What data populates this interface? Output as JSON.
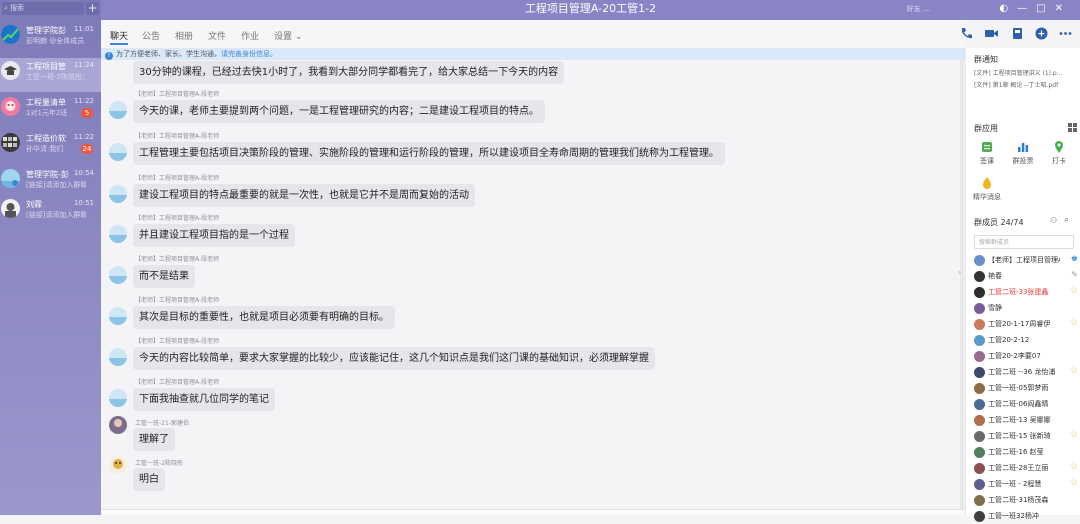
{
  "app": {
    "title": "工程项目管理A-20工管1-2",
    "titlebar_mini": "好友 …"
  },
  "left": {
    "search_placeholder": "搜索",
    "plus": "+",
    "sessions": [
      {
        "name": "管理学院彭",
        "time": "11:01",
        "preview": "彭明朗 @全体成员",
        "badge": ""
      },
      {
        "name": "工程项目管",
        "time": "11:24",
        "preview": "工管一班-2陈晓彤：明",
        "badge": ""
      },
      {
        "name": "工程量清单",
        "time": "11:22",
        "preview": "1对1元年2班",
        "badge": "5"
      },
      {
        "name": "工程造价软",
        "time": "11:22",
        "preview": "孙华清:我们",
        "badge": "24"
      },
      {
        "name": "管理学院-彭",
        "time": "10:54",
        "preview": "[链接]请添加入群聊",
        "badge": ""
      },
      {
        "name": "刘霖",
        "time": "10:51",
        "preview": "[链接]请添加入群聊",
        "badge": ""
      }
    ]
  },
  "tabs": [
    "聊天",
    "公告",
    "相册",
    "文件",
    "作业",
    "设置 ⌄"
  ],
  "notice": {
    "text": "为了方便老师、家长、学生沟通，",
    "link": "请完善身份信息。"
  },
  "messages": [
    {
      "sender": "",
      "text": "30分钟的课程，已经过去快1小时了，我看到大部分同学都看完了，给大家总结一下今天的内容"
    },
    {
      "sender": "【老师】工程项目管理A-段老师",
      "text": "今天的课，老师主要提到两个问题，一是工程管理研究的内容；二是建设工程项目的特点。"
    },
    {
      "sender": "【老师】工程项目管理A-段老师",
      "text": "工程管理主要包括项目决策阶段的管理、实施阶段的管理和运行阶段的管理，所以建设项目全寿命周期的管理我们统称为工程管理。"
    },
    {
      "sender": "【老师】工程项目管理A-段老师",
      "text": "建设工程项目的特点最重要的就是一次性，也就是它并不是周而复始的活动"
    },
    {
      "sender": "【老师】工程项目管理A-段老师",
      "text": "并且建设工程项目指的是一个过程"
    },
    {
      "sender": "【老师】工程项目管理A-段老师",
      "text": "而不是结果"
    },
    {
      "sender": "【老师】工程项目管理A-段老师",
      "text": "其次是目标的重要性，也就是项目必须要有明确的目标。"
    },
    {
      "sender": "【老师】工程项目管理A-段老师",
      "text": "今天的内容比较简单，要求大家掌握的比较少，应该能记住，这几个知识点是我们这门课的基础知识，必须理解掌握"
    },
    {
      "sender": "【老师】工程项目管理A-段老师",
      "text": "下面我抽查就几位同学的笔记"
    },
    {
      "sender": "工管一班-21-郭建伯",
      "text": "理解了"
    },
    {
      "sender": "工管一班-2陈晓彤",
      "text": "明白"
    }
  ],
  "right": {
    "group_notice_title": "群通知",
    "files": [
      "[文件] 工程项目管理讲义 (1).p...",
      "[文件] 第1章 概论 --丁士昭.pdf"
    ],
    "apps_title": "群应用",
    "apps": [
      "签课",
      "群投票",
      "打卡",
      "精华消息"
    ],
    "members_title": "群成员 24/74",
    "member_search_placeholder": "搜索群成员",
    "members": [
      {
        "name": "【老师】工程项目管理A",
        "mark": "owner"
      },
      {
        "name": "艳春",
        "mark": "edit"
      },
      {
        "name": "工管二班-33张建鑫",
        "mark": "star",
        "red": true
      },
      {
        "name": "雪静",
        "mark": ""
      },
      {
        "name": "工管20-1-17周睿伊",
        "mark": "star"
      },
      {
        "name": "工管20-2-12",
        "mark": ""
      },
      {
        "name": "工管20-2李要07",
        "mark": ""
      },
      {
        "name": "工管二班 --36 龙怡浦",
        "mark": "star"
      },
      {
        "name": "工管一班-05郭梦雨",
        "mark": ""
      },
      {
        "name": "工管二班-06阎鑫晴",
        "mark": ""
      },
      {
        "name": "工管二班-13 吴娜娜",
        "mark": ""
      },
      {
        "name": "工管二班-15 张新琦",
        "mark": "star"
      },
      {
        "name": "工管二班-16 赵莹",
        "mark": ""
      },
      {
        "name": "工管二班-28王立丽",
        "mark": "star"
      },
      {
        "name": "工管一班 - 2程慧",
        "mark": "star"
      },
      {
        "name": "工管二班-31杨茂森",
        "mark": ""
      },
      {
        "name": "工管一班32杨冲",
        "mark": ""
      }
    ]
  },
  "colors": {
    "sidebar": "#8884c6",
    "accent": "#3a86d8",
    "bubble": "#e6e6ea",
    "badge": "#f2553b",
    "star": "#f3b51d"
  }
}
